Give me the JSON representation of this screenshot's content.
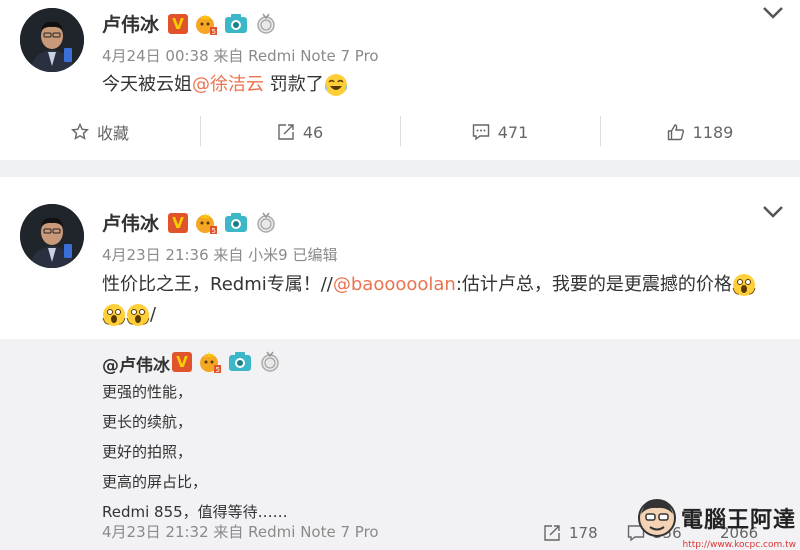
{
  "posts": [
    {
      "author": "卢伟冰",
      "meta": "4月24日 00:38 来自 Redmi Note 7 Pro",
      "text_before": "今天被云姐",
      "mention": "@徐洁云",
      "text_after": " 罚款了",
      "actions": {
        "favorite": "收藏",
        "repost": "46",
        "comment": "471",
        "like": "1189"
      }
    },
    {
      "author": "卢伟冰",
      "meta": "4月23日 21:36 来自 小米9   已编辑",
      "line1_before": "性价比之王，Redmi专属！//",
      "mention": "@baooooolan",
      "line1_after": ":估计卢总，我要的是更震撼的价格",
      "line2_after": "/",
      "quote": {
        "author": "@卢伟冰",
        "lines": [
          "更强的性能，",
          "更长的续航，",
          "更好的拍照，",
          "更高的屏占比，",
          "Redmi 855，值得等待……"
        ],
        "meta": "4月23日 21:32 来自 Redmi Note 7 Pro",
        "repost": "178",
        "comment": "356",
        "like": "2066"
      }
    }
  ],
  "watermark": {
    "text": "電腦王阿達",
    "url": "http://www.kocpc.com.tw"
  },
  "colors": {
    "mention": "#eb7350",
    "badge": "#e1532a",
    "divider": "#eef0f3"
  }
}
